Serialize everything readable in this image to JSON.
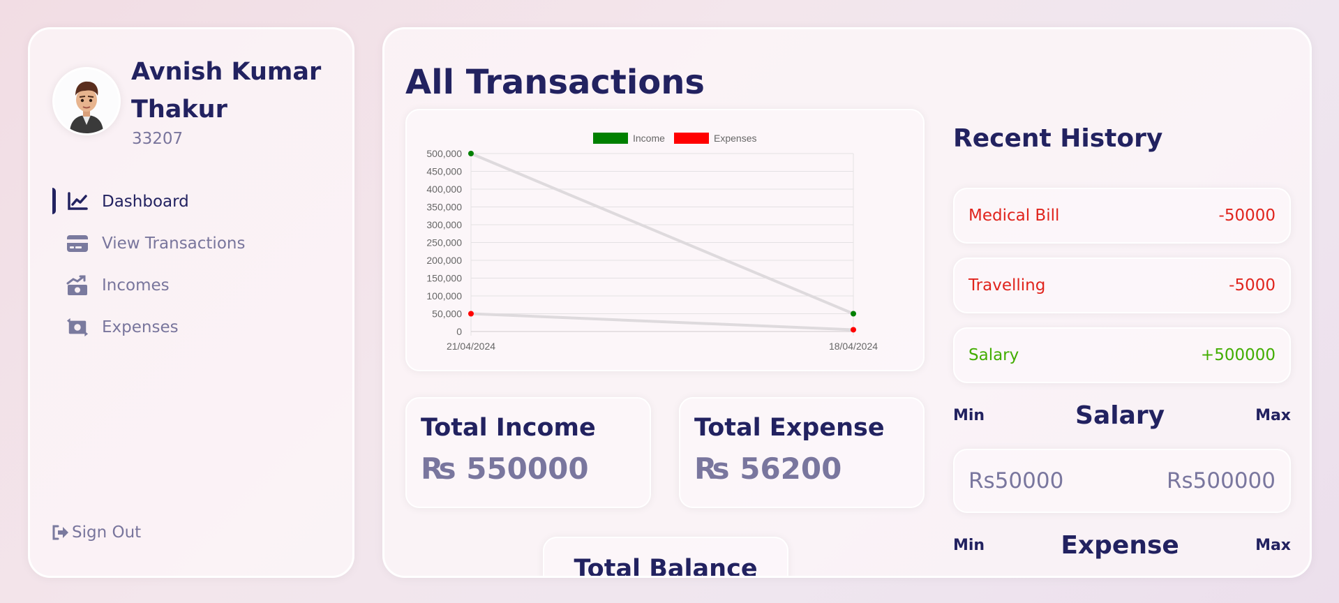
{
  "user": {
    "name": "Avnish Kumar Thakur",
    "id": "33207"
  },
  "nav": {
    "items": [
      {
        "label": "Dashboard",
        "icon": "chart-line-icon",
        "active": true
      },
      {
        "label": "View Transactions",
        "icon": "credit-card-icon",
        "active": false
      },
      {
        "label": "Incomes",
        "icon": "money-bill-trend-up-icon",
        "active": false
      },
      {
        "label": "Expenses",
        "icon": "money-bill-transfer-icon",
        "active": false
      }
    ],
    "signout_label": "Sign Out"
  },
  "main": {
    "title": "All Transactions",
    "total_income": {
      "title": "Total Income",
      "currency": "₨",
      "value": "550000"
    },
    "total_expense": {
      "title": "Total Expense",
      "currency": "₨",
      "value": "56200"
    },
    "total_balance": {
      "title": "Total Balance"
    }
  },
  "history": {
    "title": "Recent History",
    "items": [
      {
        "label": "Medical Bill",
        "amount": "-50000",
        "type": "expense"
      },
      {
        "label": "Travelling",
        "amount": "-5000",
        "type": "expense"
      },
      {
        "label": "Salary",
        "amount": "+500000",
        "type": "income"
      }
    ]
  },
  "salary_range": {
    "min_label": "Min",
    "title": "Salary",
    "max_label": "Max",
    "min": "Rs50000",
    "max": "Rs500000"
  },
  "expense_range": {
    "min_label": "Min",
    "title": "Expense",
    "max_label": "Max"
  },
  "colors": {
    "primary": "#222260",
    "income": "#008000",
    "expense": "#ff0000",
    "negative_text": "#e0241d",
    "positive_text": "#42ad00"
  },
  "chart_data": {
    "type": "line",
    "x": [
      "21/04/2024",
      "18/04/2024"
    ],
    "series": [
      {
        "name": "Income",
        "values": [
          500000,
          50000
        ],
        "color": "#008000"
      },
      {
        "name": "Expenses",
        "values": [
          50000,
          5000
        ],
        "color": "#ff0000"
      }
    ],
    "ylim": [
      0,
      500000
    ],
    "yticks": [
      "500,000",
      "450,000",
      "400,000",
      "350,000",
      "300,000",
      "250,000",
      "200,000",
      "150,000",
      "100,000",
      "50,000",
      "0"
    ],
    "legend": "top",
    "grid": true
  }
}
